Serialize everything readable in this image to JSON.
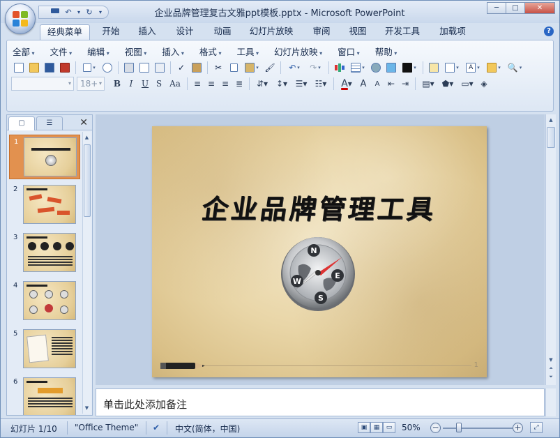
{
  "window": {
    "title": "企业品牌管理复古文雅ppt模板.pptx - Microsoft PowerPoint",
    "min": "─",
    "max": "□",
    "close": "✕"
  },
  "qat": {
    "save_icon": "save-icon",
    "undo": "↶",
    "redo": "↻",
    "more": "▾"
  },
  "tabs": [
    "经典菜单",
    "开始",
    "插入",
    "设计",
    "动画",
    "幻灯片放映",
    "审阅",
    "视图",
    "开发工具",
    "加载项"
  ],
  "help_label": "?",
  "menu": [
    "全部",
    "文件",
    "编辑",
    "视图",
    "插入",
    "格式",
    "工具",
    "幻灯片放映",
    "窗口",
    "帮助"
  ],
  "toolbar": {
    "font_name": "",
    "font_size": "18+",
    "bold": "B",
    "italic": "I",
    "underline": "U",
    "strike": "S",
    "case": "Aa",
    "font_color": "A",
    "grow": "A",
    "shrink": "A"
  },
  "slides_panel": {
    "tab_close": "✕",
    "thumbnails": [
      {
        "num": "1",
        "selected": true
      },
      {
        "num": "2",
        "selected": false
      },
      {
        "num": "3",
        "selected": false
      },
      {
        "num": "4",
        "selected": false
      },
      {
        "num": "5",
        "selected": false
      },
      {
        "num": "6",
        "selected": false
      }
    ]
  },
  "slide": {
    "title": "企业品牌管理工具",
    "page_number": "1",
    "compass_letters": [
      "N",
      "E",
      "S",
      "W"
    ]
  },
  "notes": {
    "placeholder": "单击此处添加备注"
  },
  "status": {
    "slide_info": "幻灯片 1/10",
    "theme": "\"Office Theme\"",
    "language": "中文(简体，中国)",
    "zoom": "50%",
    "zoom_level": 0.5
  },
  "colors": {
    "accent": "#e2914f",
    "ribbon": "#dde7f4",
    "title_bar": "#c9d8ec"
  }
}
